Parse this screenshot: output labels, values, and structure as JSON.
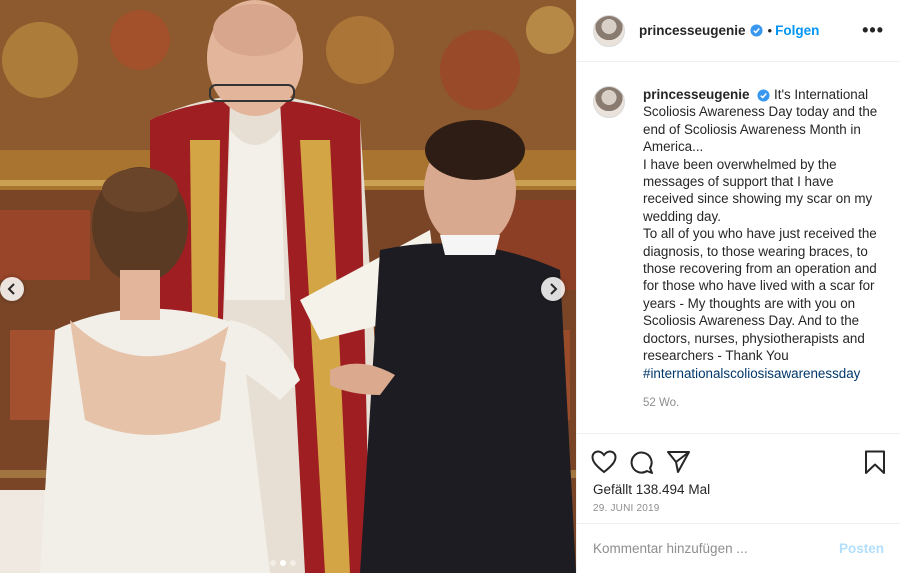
{
  "post": {
    "username": "princesseugenie",
    "follow_label": "Folgen",
    "dot_separator": "•",
    "more_label": "•••",
    "caption": "It's International Scoliosis Awareness Day today and the end of Scoliosis Awareness Month in America...\nI have been overwhelmed by the messages of support that I have received since showing my scar on my wedding day.\nTo all of you who have just received the diagnosis, to those wearing braces, to those recovering from an operation and for those who have lived with a scar for years - My thoughts are with you on Scoliosis Awareness Day. And to the doctors, nurses, physiotherapists and researchers - Thank You",
    "hashtag": "#internationalscoliosisawarenessday",
    "time_ago": "52 Wo.",
    "likes": "Gefällt 138.494 Mal",
    "date": "29. JUNI 2019",
    "comment_placeholder": "Kommentar hinzufügen ...",
    "post_label": "Posten"
  },
  "carousel": {
    "slide_count": 3,
    "active_index": 1
  },
  "icons": {
    "verified": "verified-badge-icon",
    "like": "heart-icon",
    "comment": "comment-icon",
    "share": "paper-plane-icon",
    "save": "bookmark-icon",
    "prev": "chevron-left-icon",
    "next": "chevron-right-icon"
  },
  "colors": {
    "link_blue": "#0095f6",
    "hashtag_blue": "#00376b",
    "post_button_disabled": "#b2dffc",
    "muted_text": "#8e8e8e"
  }
}
